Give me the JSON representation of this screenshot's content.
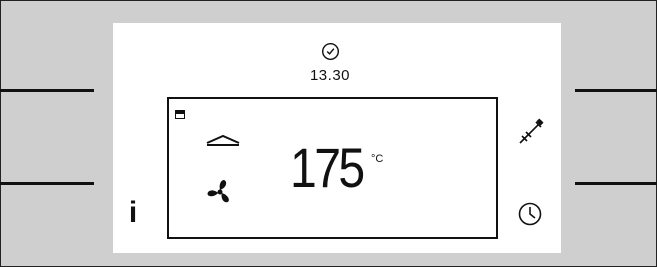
{
  "display": {
    "clock_time": "13.30",
    "temperature": "175",
    "temperature_unit": "°C"
  },
  "icons": {
    "top_clock": "clock-icon",
    "door": "door-lock-icon",
    "heating": "top-heat-icon",
    "fan": "fan-icon",
    "probe": "meat-probe-icon",
    "timer": "timer-icon"
  },
  "buttons": {
    "info_label": "i"
  },
  "colors": {
    "bezel": "#cfcfcf",
    "panel": "#ffffff",
    "ink": "#111111"
  }
}
